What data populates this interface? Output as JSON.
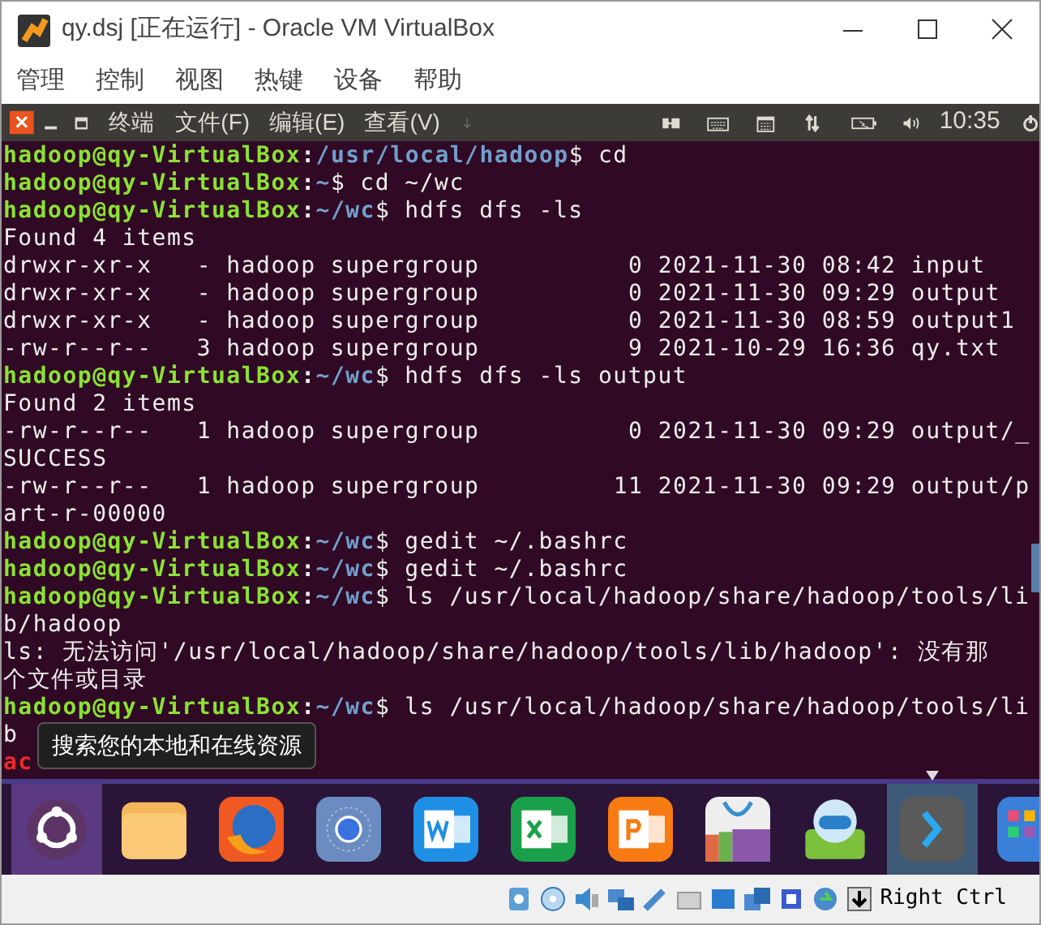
{
  "window": {
    "title": "qy.dsj [正在运行] - Oracle VM VirtualBox"
  },
  "menu_bar": {
    "items": [
      "管理",
      "控制",
      "视图",
      "热键",
      "设备",
      "帮助"
    ]
  },
  "top_panel": {
    "app_name": "终端",
    "menus": [
      "文件(F)",
      "编辑(E)",
      "查看(V)"
    ],
    "clock": "10:35"
  },
  "terminal": {
    "lines": [
      {
        "kind": "prompt",
        "user": "hadoop@qy-VirtualBox",
        "colon": ":",
        "path": "/usr/local/hadoop",
        "symbol": "$",
        "command": "cd"
      },
      {
        "kind": "prompt",
        "user": "hadoop@qy-VirtualBox",
        "colon": ":",
        "path": "~",
        "symbol": "$",
        "command": "cd ~/wc"
      },
      {
        "kind": "prompt",
        "user": "hadoop@qy-VirtualBox",
        "colon": ":",
        "path": "~/wc",
        "symbol": "$",
        "command": "hdfs dfs -ls"
      },
      {
        "kind": "output",
        "text": "Found 4 items"
      },
      {
        "kind": "output",
        "text": "drwxr-xr-x   - hadoop supergroup          0 2021-11-30 08:42 input"
      },
      {
        "kind": "output",
        "text": "drwxr-xr-x   - hadoop supergroup          0 2021-11-30 09:29 output"
      },
      {
        "kind": "output",
        "text": "drwxr-xr-x   - hadoop supergroup          0 2021-11-30 08:59 output1"
      },
      {
        "kind": "output",
        "text": "-rw-r--r--   3 hadoop supergroup          9 2021-10-29 16:36 qy.txt"
      },
      {
        "kind": "prompt",
        "user": "hadoop@qy-VirtualBox",
        "colon": ":",
        "path": "~/wc",
        "symbol": "$",
        "command": "hdfs dfs -ls output"
      },
      {
        "kind": "output",
        "text": "Found 2 items"
      },
      {
        "kind": "output",
        "text": "-rw-r--r--   1 hadoop supergroup          0 2021-11-30 09:29 output/_"
      },
      {
        "kind": "output",
        "text": "SUCCESS"
      },
      {
        "kind": "output",
        "text": "-rw-r--r--   1 hadoop supergroup         11 2021-11-30 09:29 output/p"
      },
      {
        "kind": "output",
        "text": "art-r-00000"
      },
      {
        "kind": "prompt",
        "user": "hadoop@qy-VirtualBox",
        "colon": ":",
        "path": "~/wc",
        "symbol": "$",
        "command": "gedit ~/.bashrc"
      },
      {
        "kind": "prompt",
        "user": "hadoop@qy-VirtualBox",
        "colon": ":",
        "path": "~/wc",
        "symbol": "$",
        "command": "gedit ~/.bashrc"
      },
      {
        "kind": "prompt",
        "user": "hadoop@qy-VirtualBox",
        "colon": ":",
        "path": "~/wc",
        "symbol": "$",
        "command": "ls /usr/local/hadoop/share/hadoop/tools/li"
      },
      {
        "kind": "output",
        "text": "b/hadoop"
      },
      {
        "kind": "output",
        "text": "ls: 无法访问'/usr/local/hadoop/share/hadoop/tools/lib/hadoop': 没有那"
      },
      {
        "kind": "output",
        "text": "个文件或目录"
      },
      {
        "kind": "prompt",
        "user": "hadoop@qy-VirtualBox",
        "colon": ":",
        "path": "~/wc",
        "symbol": "$",
        "command": "ls /usr/local/hadoop/share/hadoop/tools/li"
      },
      {
        "kind": "output",
        "text": "b"
      },
      {
        "kind": "archive",
        "text": "ac"
      }
    ]
  },
  "tooltip": {
    "text": "搜索您的本地和在线资源"
  },
  "dock": {
    "items": [
      {
        "kind": "ubuntu",
        "highlighted": true,
        "running": false
      },
      {
        "kind": "folder",
        "highlighted": false,
        "running": false
      },
      {
        "kind": "firefox",
        "highlighted": false,
        "running": false
      },
      {
        "kind": "browser",
        "highlighted": false,
        "running": false
      },
      {
        "kind": "word",
        "highlighted": false,
        "running": false
      },
      {
        "kind": "excel",
        "highlighted": false,
        "running": false
      },
      {
        "kind": "powerpoint",
        "highlighted": false,
        "running": false
      },
      {
        "kind": "store",
        "highlighted": false,
        "running": false
      },
      {
        "kind": "robot",
        "highlighted": false,
        "running": false
      },
      {
        "kind": "terminal",
        "highlighted": true,
        "running": true
      },
      {
        "kind": "apps",
        "highlighted": false,
        "running": false
      }
    ]
  },
  "status_bar": {
    "host_key": "Right Ctrl"
  }
}
